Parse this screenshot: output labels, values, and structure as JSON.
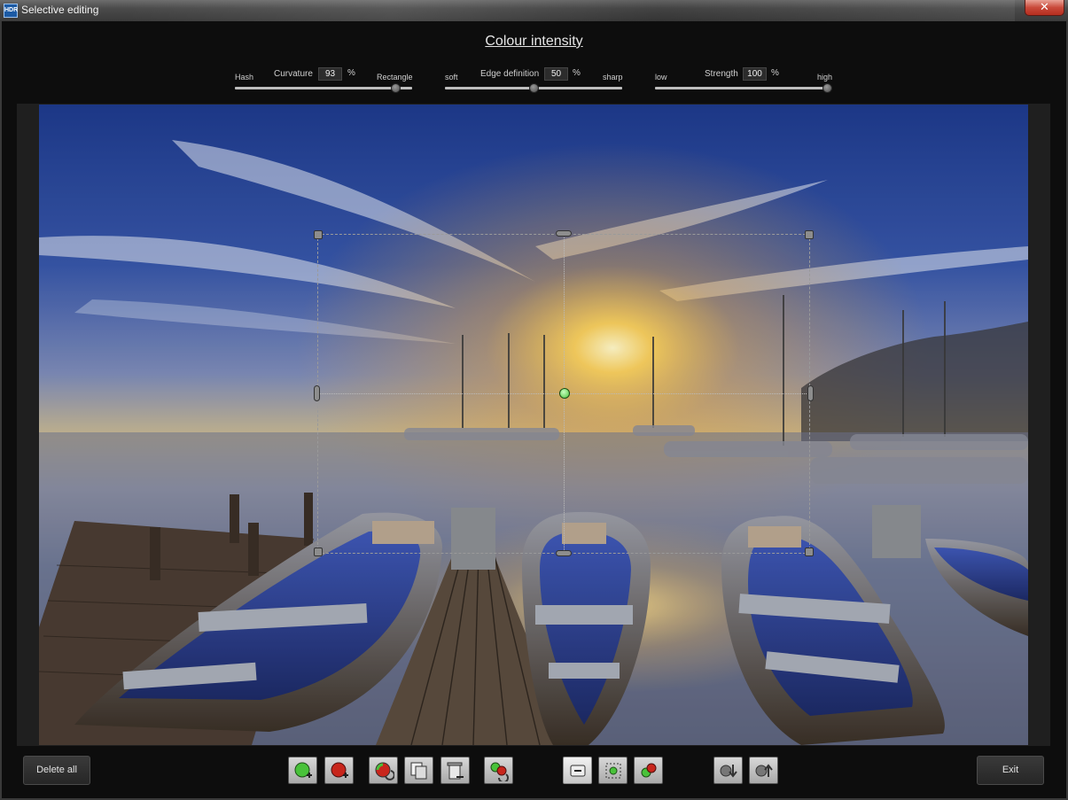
{
  "window": {
    "app_icon_text": "HDR",
    "title": "Selective editing",
    "close_glyph": "✕"
  },
  "dialog": {
    "title": "Colour intensity"
  },
  "sliders": [
    {
      "left_label": "Hash",
      "name": "Curvature",
      "value": "93",
      "unit": "%",
      "right_label": "Rectangle",
      "level_percent": 93
    },
    {
      "left_label": "soft",
      "name": "Edge definition",
      "value": "50",
      "unit": "%",
      "right_label": "sharp",
      "level_percent": 50
    },
    {
      "left_label": "low",
      "name": "Strength",
      "value": "100",
      "unit": "%",
      "right_label": "high",
      "level_percent": 100
    }
  ],
  "toolbar": {
    "delete_all_label": "Delete all",
    "exit_label": "Exit",
    "tools": [
      {
        "icon": "add-green-point-icon"
      },
      {
        "icon": "add-red-point-icon"
      },
      {
        "icon": "rotate-point-icon"
      },
      {
        "icon": "copy-icon"
      },
      {
        "icon": "delete-icon"
      },
      {
        "icon": "swap-points-icon"
      },
      {
        "icon": "minus-view-icon",
        "active": true
      },
      {
        "icon": "single-point-view-icon"
      },
      {
        "icon": "two-points-view-icon"
      },
      {
        "icon": "move-down-icon"
      },
      {
        "icon": "move-up-icon"
      }
    ]
  },
  "colors": {
    "accent_green": "#49c23a",
    "accent_red": "#c8261c",
    "close_red": "#c9493a"
  }
}
